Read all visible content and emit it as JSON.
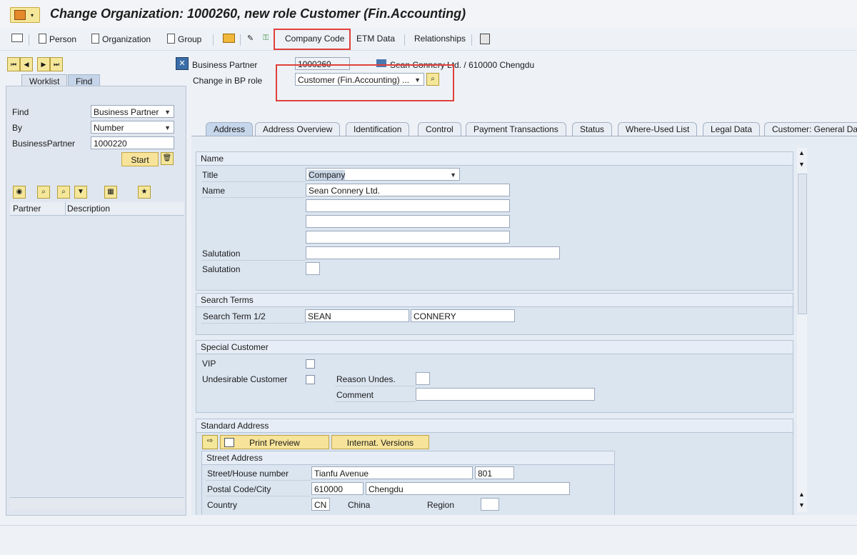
{
  "window": {
    "title": "Change Organization: 1000260, new role Customer (Fin.Accounting)"
  },
  "toolbar": {
    "person": "Person",
    "organization": "Organization",
    "group": "Group",
    "company_code": "Company Code",
    "etm_data": "ETM Data",
    "relationships": "Relationships"
  },
  "left": {
    "tabs": [
      "Worklist",
      "Find"
    ],
    "find_label": "Find",
    "find_value": "Business Partner",
    "by_label": "By",
    "by_value": "Number",
    "bp_label": "BusinessPartner",
    "bp_value": "1000220",
    "start": "Start",
    "columns": [
      "Partner",
      "Description"
    ]
  },
  "header": {
    "bp_label": "Business Partner",
    "bp_value": "1000260",
    "bp_desc": "Sean Connery Ltd. / 610000 Chengdu",
    "role_label": "Change in BP role",
    "role_value": "Customer (Fin.Accounting) ..."
  },
  "tabs": [
    "Address",
    "Address Overview",
    "Identification",
    "Control",
    "Payment Transactions",
    "Status",
    "Where-Used List",
    "Legal Data",
    "Customer: General Da"
  ],
  "name_group": {
    "title": "Name",
    "title_label": "Title",
    "title_value": "Company",
    "name_label": "Name",
    "name_value": "Sean Connery Ltd.",
    "salutation1_label": "Salutation",
    "salutation2_label": "Salutation"
  },
  "search_group": {
    "title": "Search Terms",
    "label": "Search Term 1/2",
    "term1": "SEAN",
    "term2": "CONNERY"
  },
  "special_group": {
    "title": "Special Customer",
    "vip": "VIP",
    "undesirable": "Undesirable Customer",
    "reason": "Reason Undes.",
    "comment": "Comment"
  },
  "address_group": {
    "title": "Standard Address",
    "print_preview": "Print Preview",
    "internat_versions": "Internat. Versions",
    "street_title": "Street Address",
    "street_label": "Street/House number",
    "street_value": "Tianfu Avenue",
    "house_no": "801",
    "postal_label": "Postal Code/City",
    "postal_value": "610000",
    "city_value": "Chengdu",
    "country_label": "Country",
    "country_code": "CN",
    "country_name": "China",
    "region_label": "Region"
  },
  "colors": {
    "highlight": "#e0403a",
    "button": "#f5e79a"
  }
}
